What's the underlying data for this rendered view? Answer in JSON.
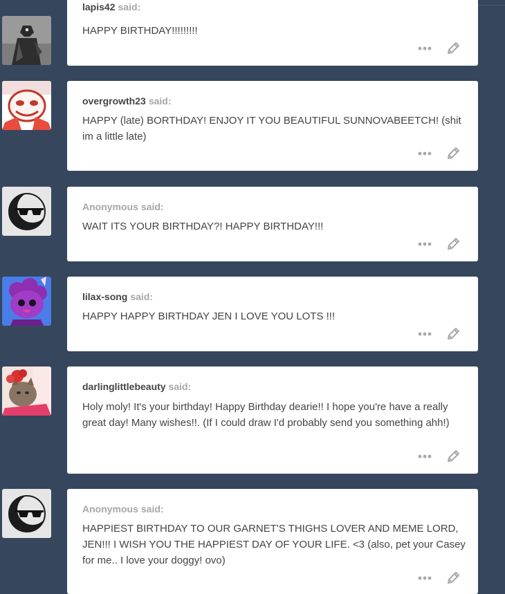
{
  "asks": [
    {
      "asker": "lapis42",
      "said": "said:",
      "message": "HAPPY BIRTHDAY!!!!!!!!!",
      "avatar_icon": "armored-figure-avatar-icon"
    },
    {
      "asker": "overgrowth23",
      "said": "said:",
      "message": "HAPPY (late) BORTHDAY! ENJOY IT YOU BEAUTIFUL SUNNOVABEETCH! (shit im a little late)",
      "avatar_icon": "skeleton-cartoon-avatar-icon"
    },
    {
      "asker": "Anonymous",
      "said": "said:",
      "message": "WAIT ITS YOUR BIRTHDAY?! HAPPY BIRTHDAY!!!",
      "avatar_icon": "anonymous-sunglasses-avatar-icon"
    },
    {
      "asker": "lilax-song",
      "said": "said:",
      "message": "HAPPY HAPPY BIRTHDAY JEN I LOVE YOU LOTS !!!",
      "avatar_icon": "purple-creature-avatar-icon"
    },
    {
      "asker": "darlinglittlebeauty",
      "said": "said:",
      "message": "Holy moly! It's your birthday! Happy Birthday dearie!! I hope you're have a really great day! Many wishes!!. (If I could draw I'd probably send you something ahh!)",
      "avatar_icon": "cat-with-flower-avatar-icon"
    },
    {
      "asker": "Anonymous",
      "said": "said:",
      "message": "HAPPIEST BIRTHDAY TO OUR GARNET'S THIGHS LOVER AND MEME LORD, JEN!!! I WISH YOU THE HAPPIEST DAY OF YOUR LIFE. <3 (also, pet your Casey for me.. I love your doggy! ovo)",
      "avatar_icon": "anonymous-sunglasses-avatar-icon"
    }
  ],
  "colors": {
    "background": "#36465d",
    "card": "#ffffff",
    "text": "#444444",
    "muted": "#a6a6a6",
    "icon": "#a8a8a8"
  },
  "icons": {
    "more": "ellipsis-icon",
    "edit": "pencil-icon"
  }
}
